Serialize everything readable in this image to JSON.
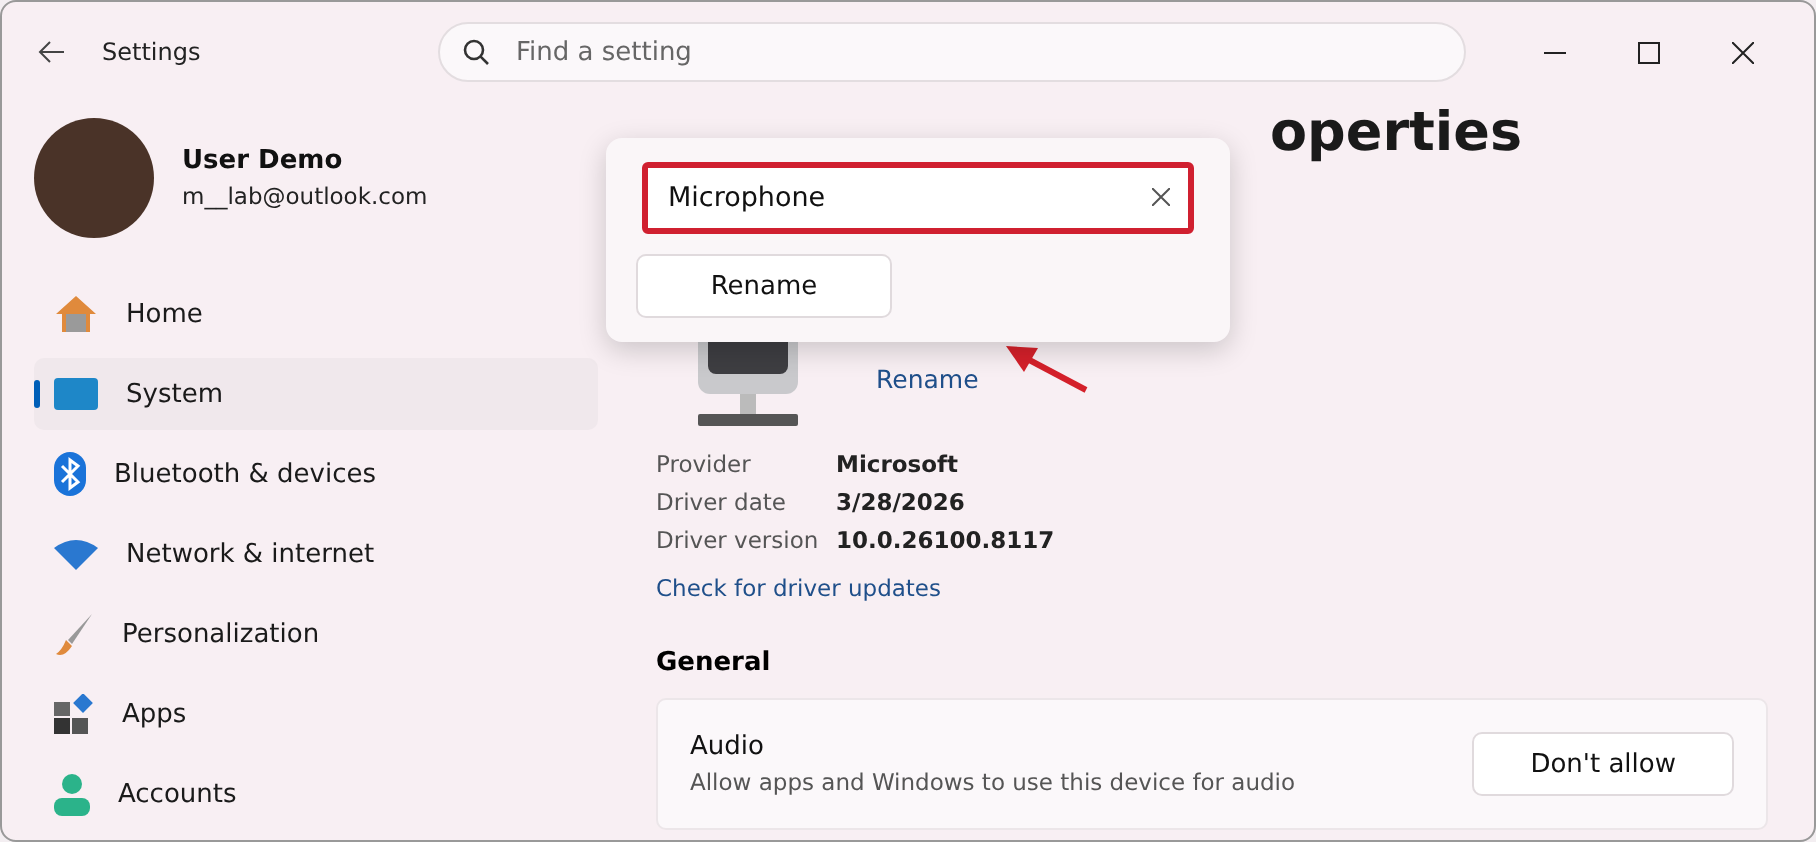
{
  "window": {
    "title": "Settings"
  },
  "search": {
    "placeholder": "Find a setting"
  },
  "user": {
    "name": "User Demo",
    "email": "m__lab@outlook.com"
  },
  "sidebar": {
    "items": [
      {
        "label": "Home",
        "kind": "home",
        "selected": false
      },
      {
        "label": "System",
        "kind": "system",
        "selected": true
      },
      {
        "label": "Bluetooth & devices",
        "kind": "bluetooth",
        "selected": false
      },
      {
        "label": "Network & internet",
        "kind": "network",
        "selected": false
      },
      {
        "label": "Personalization",
        "kind": "personalization",
        "selected": false
      },
      {
        "label": "Apps",
        "kind": "apps",
        "selected": false
      },
      {
        "label": "Accounts",
        "kind": "accounts",
        "selected": false
      }
    ]
  },
  "page": {
    "title_visible": "operties",
    "rename_link": "Rename",
    "details": [
      {
        "label": "Provider",
        "value": "Microsoft"
      },
      {
        "label": "Driver date",
        "value": "3/28/2026"
      },
      {
        "label": "Driver version",
        "value": "10.0.26100.8117"
      }
    ],
    "driver_link": "Check for driver updates",
    "section": "General",
    "card": {
      "title": "Audio",
      "description": "Allow apps and Windows to use this device for audio",
      "button": "Don't allow"
    }
  },
  "rename_popup": {
    "value": "Microphone",
    "button": "Rename"
  }
}
